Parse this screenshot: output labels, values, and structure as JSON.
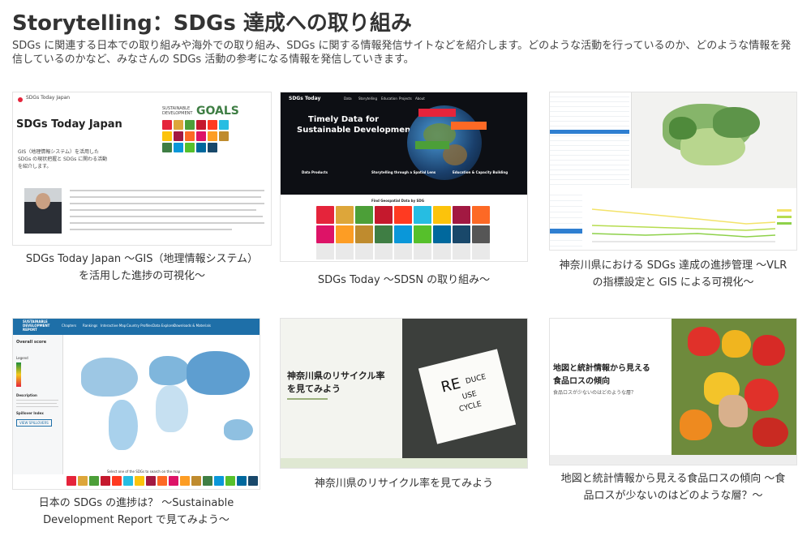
{
  "header": {
    "title": "Storytelling：SDGs 達成への取り組み",
    "description": "SDGs に関連する日本での取り組みや海外での取り組み、SDGs に関する情報発信サイトなどを紹介します。どのような活動を行っているのか、どのような情報を発信しているのかなど、みなさんの SDGs 活動の参考になる情報を発信していきます。"
  },
  "sdg_colors": [
    "#e5243b",
    "#dda63a",
    "#4c9f38",
    "#c5192d",
    "#ff3a21",
    "#26bde2",
    "#fcc30b",
    "#a21942",
    "#fd6925",
    "#dd1367",
    "#fd9d24",
    "#bf8b2e",
    "#3f7e44",
    "#0a97d9",
    "#56c02b",
    "#00689d",
    "#19486a",
    "#565656"
  ],
  "cards": [
    {
      "caption_line1": "SDGs Today Japan 〜GIS（地理情報システム）",
      "caption_line2": "を活用した進捗の可視化〜",
      "thumb": {
        "logo_text": "SDGs Today Japan",
        "big_title": "SDGs Today Japan",
        "goals_line1": "SUSTAINABLE",
        "goals_line2": "DEVELOPMENT",
        "goals_word": "GOALS",
        "body_line1": "GIS（地理情報システム）を活用した",
        "body_line2": "SDGs の現状把握と SDGs に関わる活動",
        "body_line3": "を紹介します。"
      }
    },
    {
      "caption_line1": "SDGs Today 〜SDSN の取り組み〜",
      "thumb": {
        "brand": "SDGs Today",
        "nav": [
          "Data",
          "Storytelling",
          "Education",
          "Projects",
          "About"
        ],
        "hero_line1": "Timely Data for",
        "hero_line2": "Sustainable Development",
        "col1": "Data Products",
        "col2": "Storytelling through a Spatial Lens",
        "col3": "Education & Capacity Building",
        "find_text": "Find Geospatial Data by SDG"
      }
    },
    {
      "caption_line1": "神奈川県における SDGs 達成の進捗管理 〜VLR",
      "caption_line2": "の指標設定と GIS による可視化〜",
      "thumb": {}
    },
    {
      "caption_line1": "日本の SDGs の進捗は？ 〜Sustainable",
      "caption_line2": "Development Report で見てみよう〜",
      "thumb": {
        "brand_line1": "SUSTAINABLE",
        "brand_line2": "DEVELOPMENT",
        "brand_line3": "REPORT",
        "nav": [
          "Chapters",
          "Rankings",
          "Interactive Map",
          "Country Profiles",
          "Data Explorer",
          "Downloads & Materials"
        ],
        "side_title": "Overall score",
        "side_legend": "Legend",
        "side_desc": "Description",
        "side_spillover": "Spillover Index",
        "side_button": "VIEW SPILLOVERS",
        "bottom_text": "Select one of the SDGs to search on the map"
      }
    },
    {
      "caption_line1": "神奈川県のリサイクル率を見てみよう",
      "thumb": {
        "title_line1": "神奈川県のリサイクル率",
        "title_line2": "を見てみよう",
        "note_line1": "RE",
        "note_line2": "DUCE",
        "note_line3": "USE",
        "note_line4": "CYCLE"
      }
    },
    {
      "caption_line1": "地図と統計情報から見える食品ロスの傾向 〜食",
      "caption_line2": "品ロスが少ないのはどのような層？〜",
      "thumb": {
        "title_line1": "地図と統計情報から見える",
        "title_line2": "食品ロスの傾向",
        "subtitle": "食品ロスが少ないのはどのような層？"
      }
    }
  ]
}
